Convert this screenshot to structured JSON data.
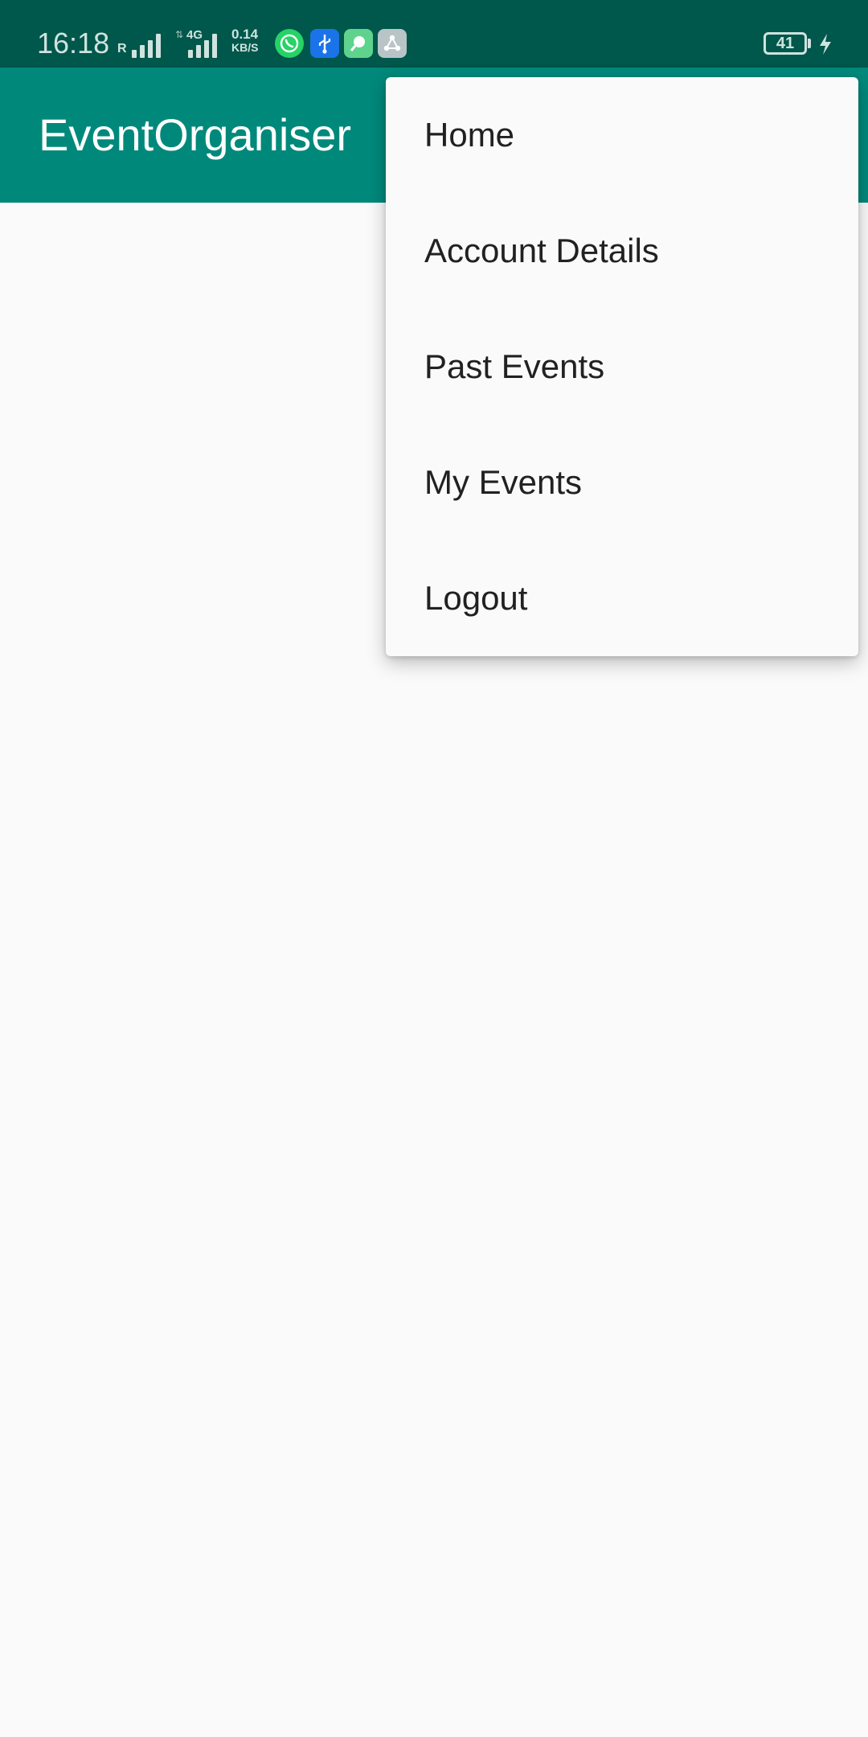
{
  "status_bar": {
    "time": "16:18",
    "roaming_label": "R",
    "network_type": "4G",
    "net_speed_value": "0.14",
    "net_speed_unit": "KB/S",
    "battery_level": "41",
    "icons": [
      "whatsapp-icon",
      "usb-icon",
      "maps-icon",
      "share-icon"
    ],
    "colors": {
      "background": "#00574b",
      "whatsapp": "#25d366",
      "usb": "#1a73e8",
      "maps": "#5fd38d",
      "share": "#b9c4c7"
    }
  },
  "app_bar": {
    "title": "EventOrganiser",
    "color": "#00897b"
  },
  "overflow_menu": {
    "items": [
      {
        "label": "Home"
      },
      {
        "label": "Account Details"
      },
      {
        "label": "Past Events"
      },
      {
        "label": "My Events"
      },
      {
        "label": "Logout"
      }
    ]
  }
}
